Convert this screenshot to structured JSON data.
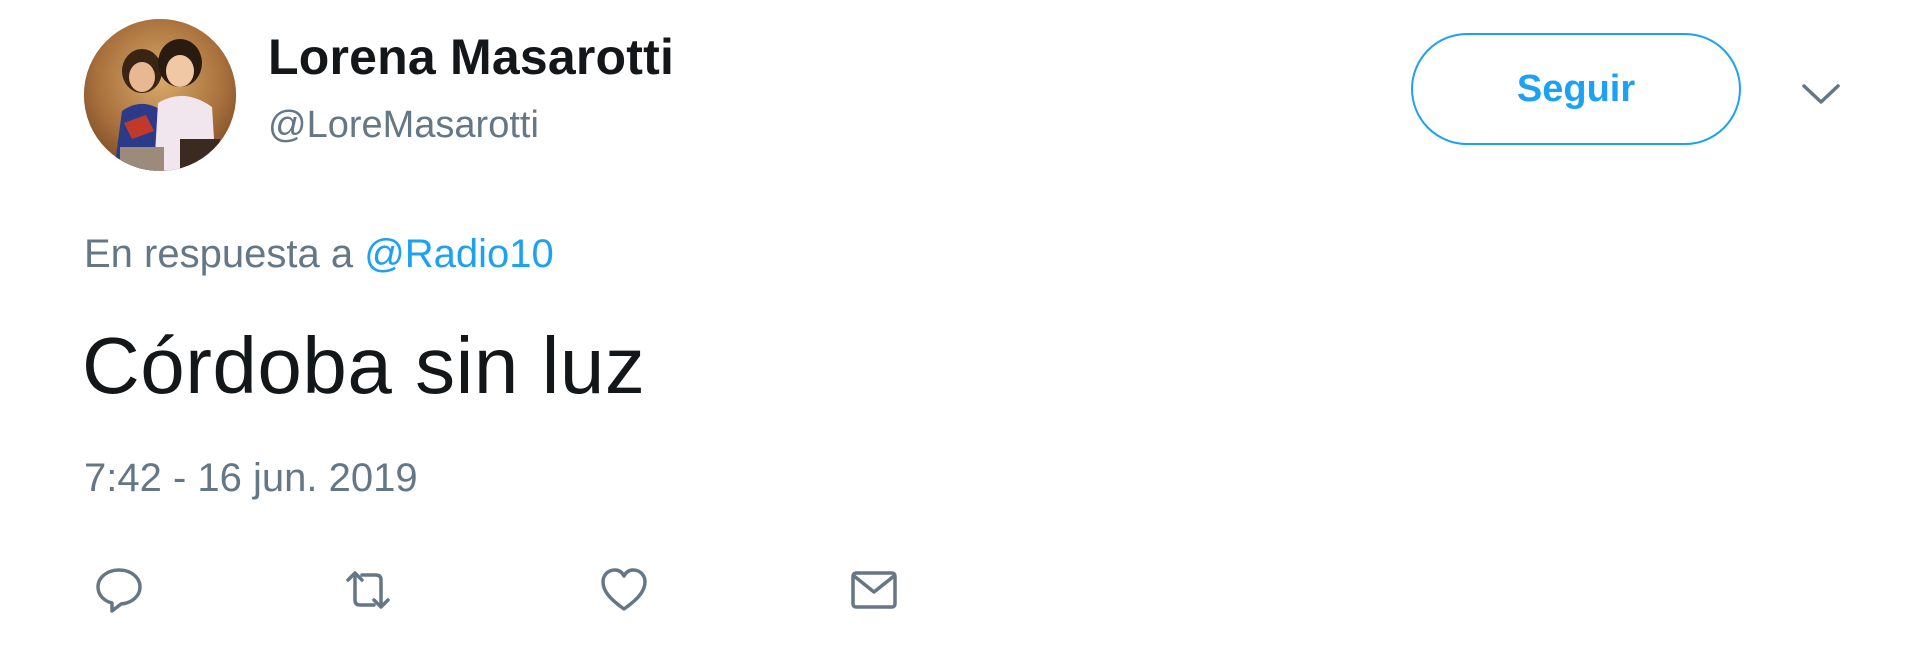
{
  "author": {
    "display_name": "Lorena Masarotti",
    "handle": "@LoreMasarotti",
    "avatar_icon": "profile-photo"
  },
  "follow_button": {
    "label": "Seguir"
  },
  "menu": {
    "icon": "chevron-down-icon"
  },
  "reply_context": {
    "prefix": "En respuesta a",
    "mention": "@Radio10"
  },
  "tweet": {
    "text": "Córdoba sin luz",
    "timestamp": "7:42 - 16 jun. 2019"
  },
  "actions": [
    {
      "name": "reply",
      "icon": "comment-icon"
    },
    {
      "name": "retweet",
      "icon": "retweet-icon"
    },
    {
      "name": "like",
      "icon": "heart-icon"
    },
    {
      "name": "direct-message",
      "icon": "envelope-icon"
    }
  ],
  "colors": {
    "accent": "#1da1f2",
    "text_primary": "#14171a",
    "text_secondary": "#657786"
  }
}
